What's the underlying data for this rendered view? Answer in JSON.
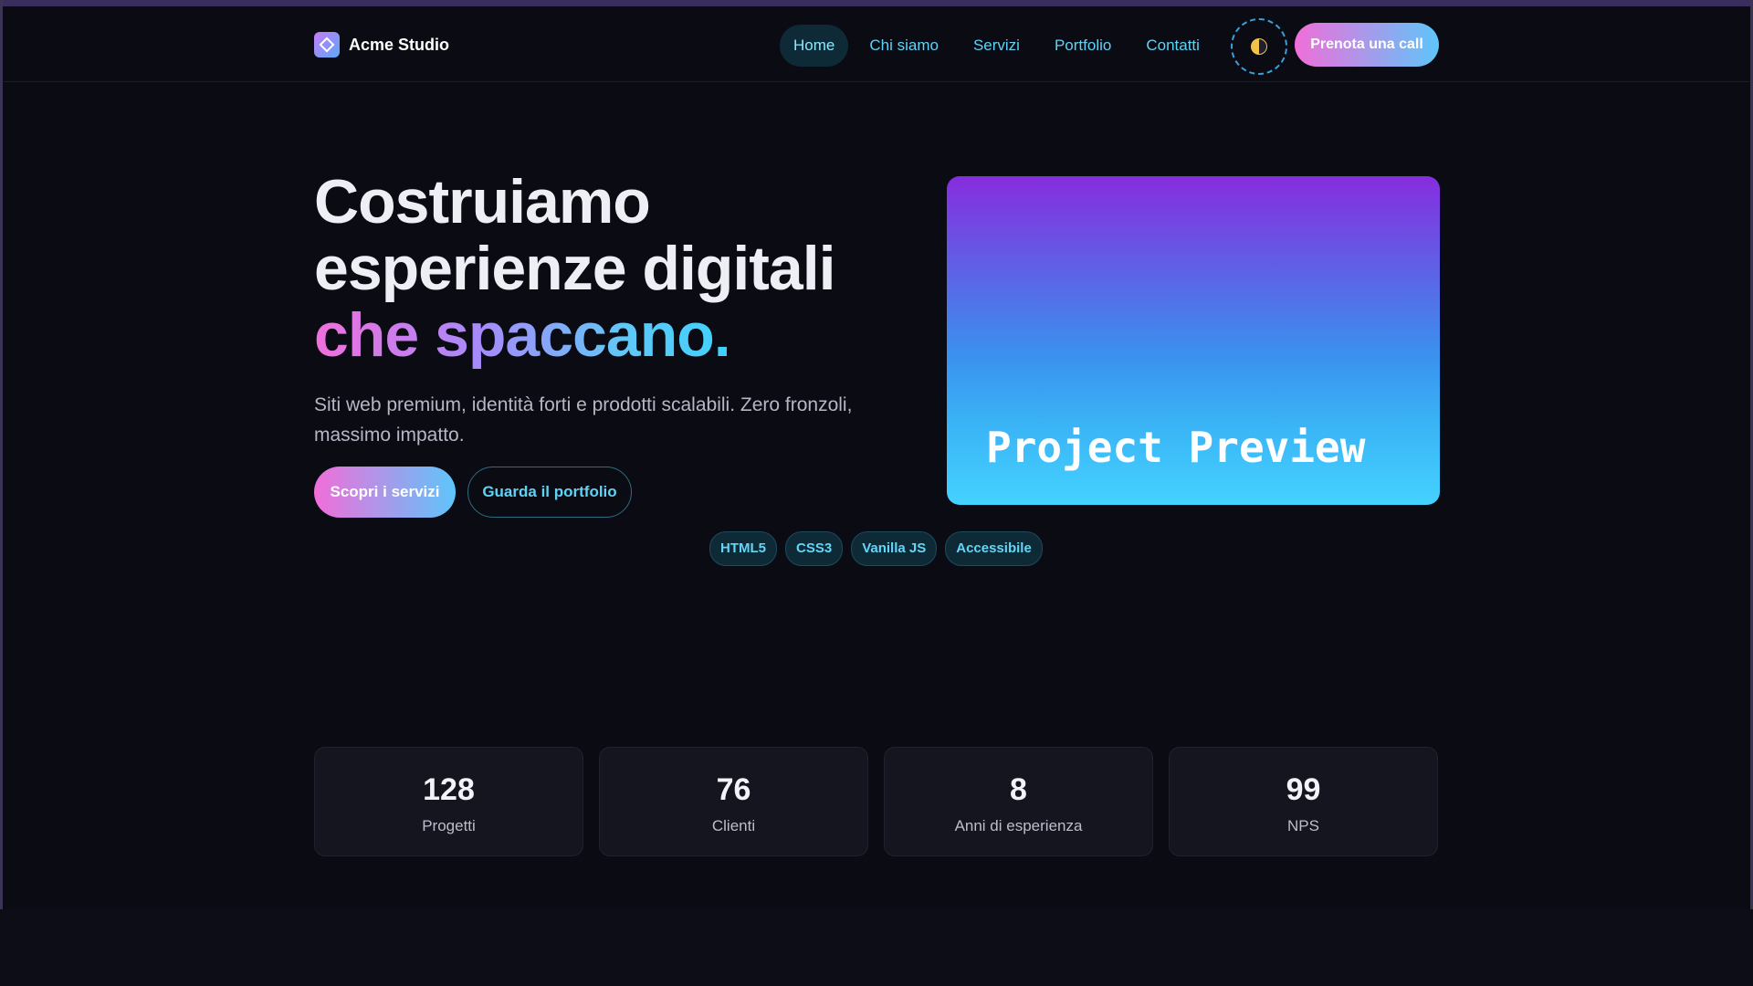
{
  "brand": {
    "name": "Acme Studio"
  },
  "nav": {
    "items": [
      "Home",
      "Chi siamo",
      "Servizi",
      "Portfolio",
      "Contatti"
    ],
    "active": "Home",
    "cta_label": "Prenota una call"
  },
  "hero": {
    "title_line1": "Costruiamo",
    "title_line2": "esperienze digitali",
    "title_accent": "che spaccano.",
    "subtitle": "Siti web premium, identità forti e prodotti scalabili. Zero fronzoli, massimo impatto.",
    "primary_button": "Scopri i servizi",
    "secondary_button": "Guarda il portfolio",
    "preview_label": "Project Preview",
    "tags": [
      "HTML5",
      "CSS3",
      "Vanilla JS",
      "Accessibile"
    ]
  },
  "stats": [
    {
      "value": "128",
      "label": "Progetti"
    },
    {
      "value": "76",
      "label": "Clienti"
    },
    {
      "value": "8",
      "label": "Anni di esperienza"
    },
    {
      "value": "99",
      "label": "NPS"
    }
  ],
  "colors": {
    "background": "#0b0b14",
    "accent_pink": "#f16ed9",
    "accent_cyan": "#5ec5fa",
    "nav_link": "#5fd3f5"
  }
}
